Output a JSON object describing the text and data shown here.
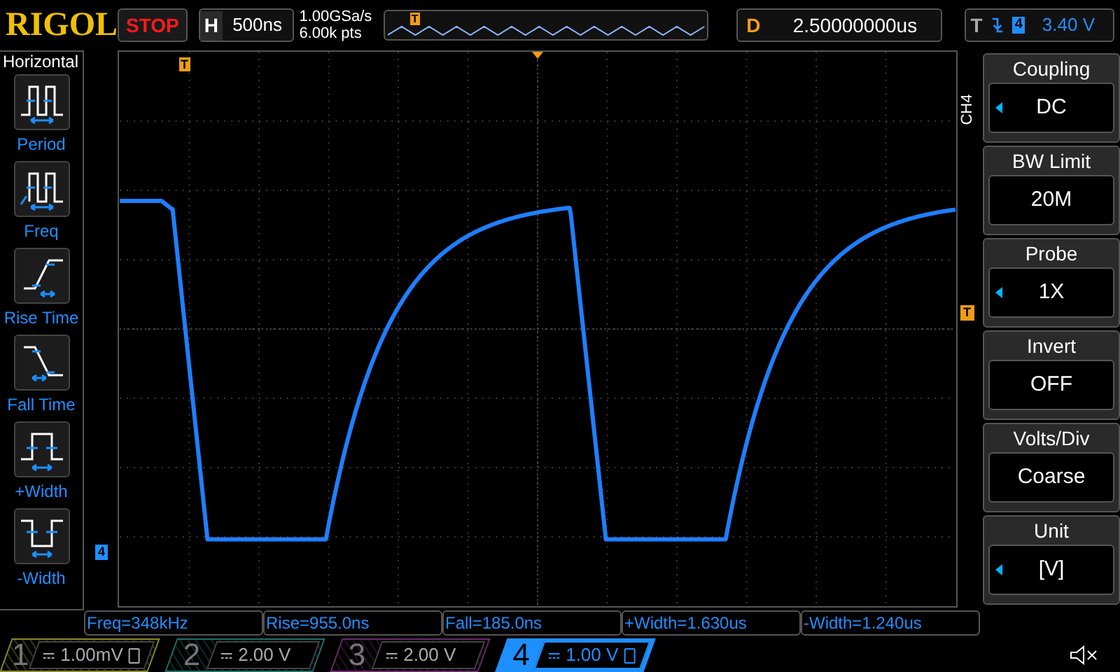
{
  "top_bar": {
    "logo": "RIGOL",
    "run_status": "STOP",
    "horizontal": {
      "label": "H",
      "timebase": "500ns"
    },
    "sample_rate": "1.00GSa/s",
    "memory_depth": "6.00k pts",
    "overview_trigger_marker": "T",
    "delay": {
      "label": "D",
      "value": "2.50000000us"
    },
    "trigger": {
      "label": "T",
      "source": "4",
      "level": "3.40 V"
    }
  },
  "left_menu": {
    "title": "Horizontal",
    "items": [
      {
        "kind": "period",
        "label": "Period"
      },
      {
        "kind": "freq",
        "label": "Freq"
      },
      {
        "kind": "rise",
        "label": "Rise Time"
      },
      {
        "kind": "fall",
        "label": "Fall Time"
      },
      {
        "kind": "pwidth",
        "label": "+Width"
      },
      {
        "kind": "nwidth",
        "label": "-Width"
      }
    ]
  },
  "graticule": {
    "trigger_position_marker": "T",
    "trigger_level_marker": "T",
    "channel_marker": "4"
  },
  "right_menu": {
    "channel": "CH4",
    "items": [
      {
        "title": "Coupling",
        "value": "DC",
        "adjustable": true
      },
      {
        "title": "BW Limit",
        "value": "20M",
        "adjustable": false
      },
      {
        "title": "Probe",
        "value": "1X",
        "adjustable": true
      },
      {
        "title": "Invert",
        "value": "OFF",
        "adjustable": false
      },
      {
        "title": "Volts/Div",
        "value": "Coarse",
        "adjustable": false
      },
      {
        "title": "Unit",
        "value": "[V]",
        "adjustable": true
      }
    ]
  },
  "measurements": [
    "Freq=348kHz",
    "Rise=955.0ns",
    "Fall=185.0ns",
    "+Width=1.630us",
    "-Width=1.240us"
  ],
  "channels": [
    {
      "number": "1",
      "scale": "1.00mV",
      "color": "#8a8a2a",
      "selected": false,
      "bw_limit": true
    },
    {
      "number": "2",
      "scale": "2.00 V",
      "color": "#1f6f6a",
      "selected": false,
      "bw_limit": false
    },
    {
      "number": "3",
      "scale": "2.00 V",
      "color": "#6a2a6a",
      "selected": false,
      "bw_limit": false
    },
    {
      "number": "4",
      "scale": "1.00 V",
      "color": "#1e8fff",
      "selected": true,
      "bw_limit": true
    }
  ]
}
